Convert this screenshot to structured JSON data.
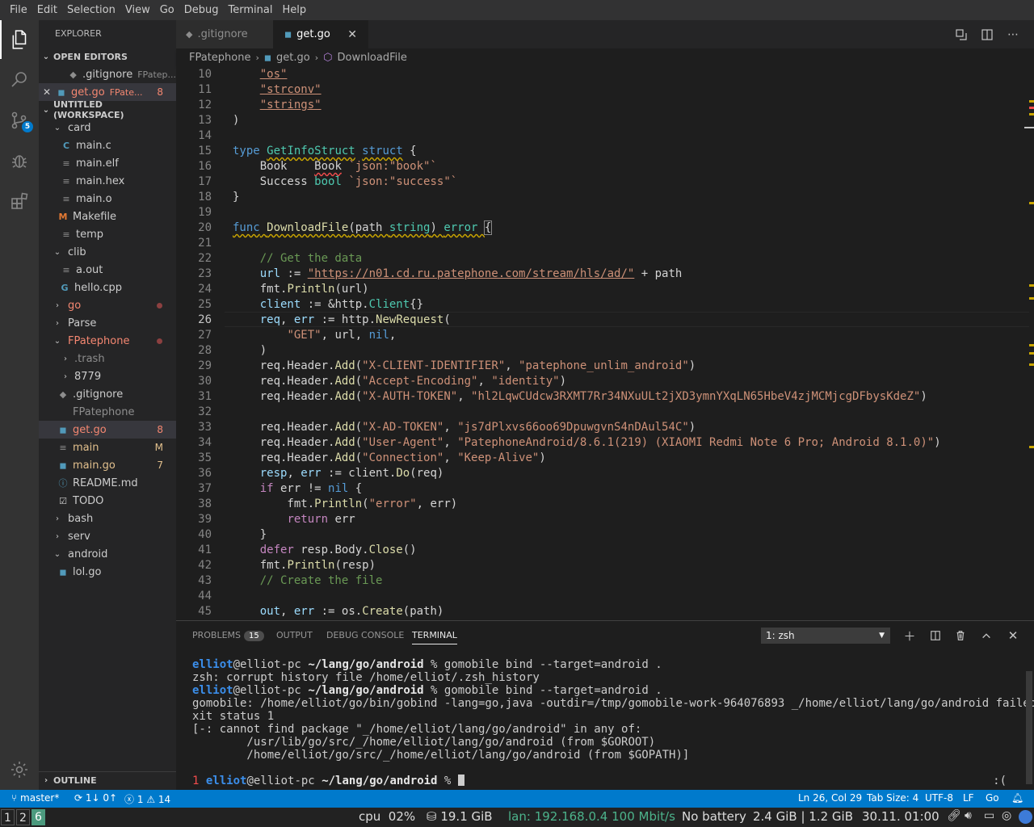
{
  "menu": [
    "File",
    "Edit",
    "Selection",
    "View",
    "Go",
    "Debug",
    "Terminal",
    "Help"
  ],
  "activity": {
    "scm_badge": "5"
  },
  "sidebar": {
    "title": "EXPLORER",
    "open_editors_label": "OPEN EDITORS",
    "open_editors": [
      {
        "name": ".gitignore",
        "path": "FPatep..."
      },
      {
        "name": "get.go",
        "path": "FPate...",
        "count": "8"
      }
    ],
    "workspace_label": "UNTITLED (WORKSPACE)",
    "tree": [
      {
        "name": "card",
        "twisty": "⌄"
      },
      {
        "name": "main.c",
        "icon": "C"
      },
      {
        "name": "main.elf",
        "icon": "≡"
      },
      {
        "name": "main.hex",
        "icon": "≡"
      },
      {
        "name": "main.o",
        "icon": "≡"
      },
      {
        "name": "Makefile",
        "icon": "M"
      },
      {
        "name": "temp",
        "icon": "≡"
      },
      {
        "name": "clib",
        "twisty": "⌄"
      },
      {
        "name": "a.out",
        "icon": "≡"
      },
      {
        "name": "hello.cpp",
        "icon": "G"
      },
      {
        "name": "go",
        "twisty": "›"
      },
      {
        "name": "Parse",
        "twisty": "›"
      },
      {
        "name": "FPatephone",
        "twisty": "⌄"
      },
      {
        "name": ".trash",
        "twisty": "›"
      },
      {
        "name": "8779",
        "twisty": "›"
      },
      {
        "name": ".gitignore",
        "icon": "◆"
      },
      {
        "name": "FPatephone",
        "icon": ""
      },
      {
        "name": "get.go",
        "icon": "◼",
        "badge": "8"
      },
      {
        "name": "main",
        "icon": "≡",
        "badge": "M"
      },
      {
        "name": "main.go",
        "icon": "◼",
        "badge": "7"
      },
      {
        "name": "README.md",
        "icon": "ⓘ"
      },
      {
        "name": "TODO",
        "icon": "☑"
      },
      {
        "name": "bash",
        "twisty": "›"
      },
      {
        "name": "serv",
        "twisty": "›"
      },
      {
        "name": "android",
        "twisty": "⌄"
      },
      {
        "name": "lol.go",
        "icon": "◼"
      }
    ],
    "outline_label": "OUTLINE"
  },
  "tabs": [
    {
      "label": ".gitignore"
    },
    {
      "label": "get.go",
      "close": "✕"
    }
  ],
  "breadcrumb": [
    "FPatephone",
    "get.go",
    "DownloadFile"
  ],
  "editor": {
    "line_numbers": [
      "10",
      "11",
      "12",
      "13",
      "14",
      "15",
      "16",
      "17",
      "18",
      "19",
      "20",
      "21",
      "22",
      "23",
      "24",
      "25",
      "26",
      "27",
      "28",
      "29",
      "30",
      "31",
      "32",
      "33",
      "34",
      "35",
      "36",
      "37",
      "38",
      "39",
      "40",
      "41",
      "42",
      "43",
      "44",
      "45"
    ],
    "strings": {
      "os": "\"os\"",
      "strconv": "\"strconv\"",
      "strings": "\"strings\"",
      "url": "\"https://n01.cd.ru.patephone.com/stream/hls/ad/\"",
      "get": "\"GET\"",
      "h1k": "\"X-CLIENT-IDENTIFIER\"",
      "h1v": "\"patephone_unlim_android\"",
      "h2k": "\"Accept-Encoding\"",
      "h2v": "\"identity\"",
      "h3k": "\"X-AUTH-TOKEN\"",
      "h3v": "\"hl2LqwCUdcw3RXMT7Rr34NXuULt2jXD3ymnYXqLN65HbeV4zjMCMjcgDFbysKdeZ\"",
      "h4k": "\"X-AD-TOKEN\"",
      "h4v": "\"js7dPlxvs66oo69DpuwgvnS4nDAul54C\"",
      "h5k": "\"User-Agent\"",
      "h5v": "\"PatephoneAndroid/8.6.1(219) (XIAOMI Redmi Note 6 Pro; Android 8.1.0)\"",
      "h6k": "\"Connection\"",
      "h6v": "\"Keep-Alive\"",
      "error": "\"error\"",
      "tag_book": "`json:\"book\"`",
      "tag_success": "`json:\"success\"`"
    },
    "comments": {
      "get_data": "// Get the data",
      "create_file": "// Create the file"
    }
  },
  "panel": {
    "tabs": [
      "PROBLEMS",
      "OUTPUT",
      "DEBUG CONSOLE",
      "TERMINAL"
    ],
    "problems_count": "15",
    "terminal_select": "1: zsh",
    "terminal": {
      "user": "elliot",
      "host": "@elliot-pc",
      "cwd": "~/lang/go/android",
      "cmd": "gomobile bind --target=android .",
      "line2": "zsh: corrupt history file /home/elliot/.zsh_history",
      "line4": "gomobile: /home/elliot/go/bin/gobind -lang=go,java -outdir=/tmp/gomobile-work-964076893 _/home/elliot/lang/go/android failed: e",
      "line5": "xit status 1",
      "line6": "[-: cannot find package \"_/home/elliot/lang/go/android\" in any of:",
      "line7": "        /usr/lib/go/src/_/home/elliot/lang/go/android (from $GOROOT)",
      "line8": "        /home/elliot/go/src/_/home/elliot/lang/go/android (from $GOPATH)]",
      "exit_code": "1",
      "rprompt": ":("
    }
  },
  "status": {
    "branch": "master*",
    "sync": "1↓ 0↑",
    "errors": "1",
    "warnings": "14",
    "position": "Ln 26, Col 29",
    "tab_size": "Tab Size: 4",
    "encoding": "UTF-8",
    "eol": "LF",
    "language": "Go"
  },
  "osbar": {
    "workspaces": [
      "1",
      "2",
      "6"
    ],
    "cpu": "cpu  02%",
    "disk": "⛁ 19.1 GiB",
    "lan": "lan: 192.168.0.4 100 Mbit/s",
    "battery": "No battery",
    "mem": "2.4 GiB | 1.2 GiB",
    "datetime": "30.11. 01:00",
    "colors": {
      "lan": "#4cb38b",
      "active_ws": "#4c9a7e"
    }
  }
}
